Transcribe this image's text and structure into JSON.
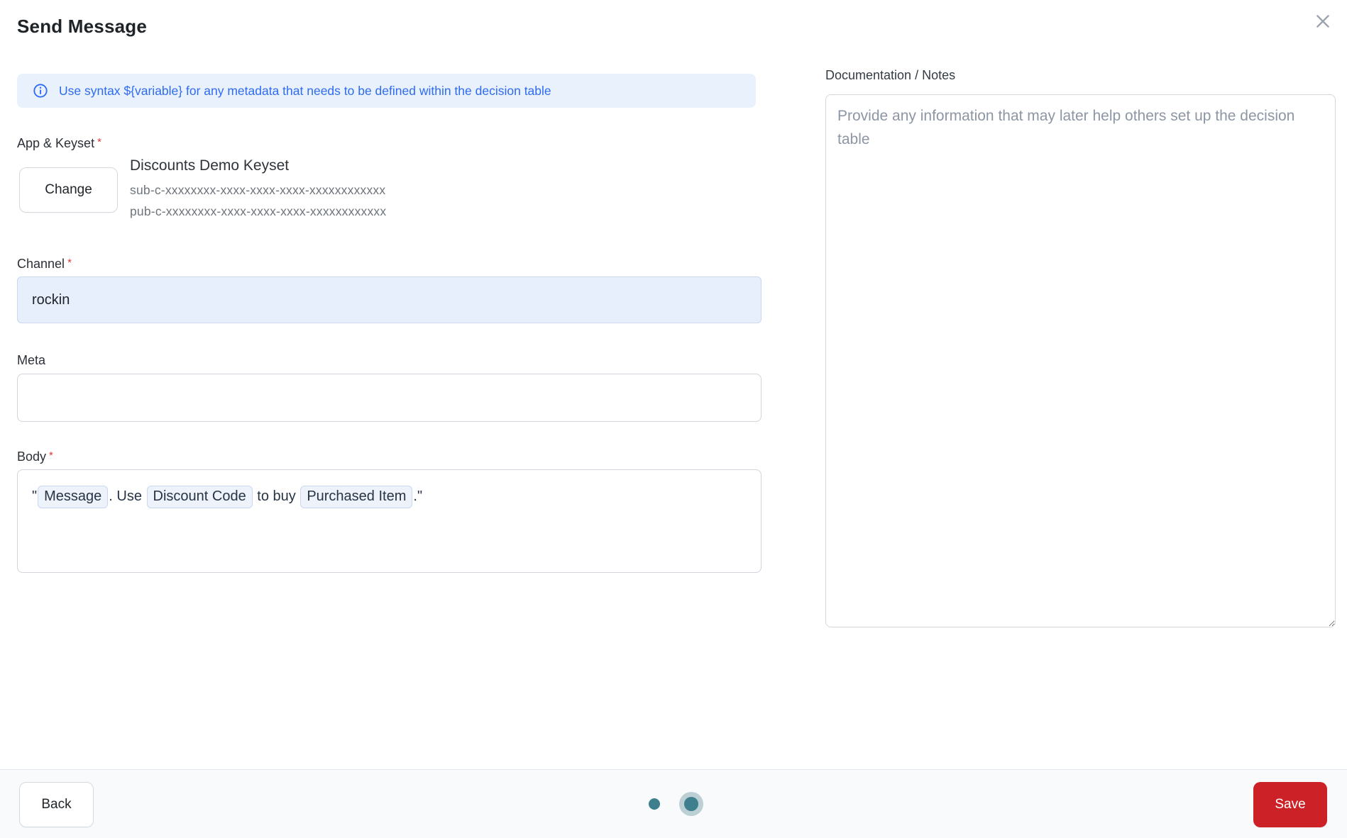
{
  "dialog": {
    "title": "Send Message"
  },
  "banner": {
    "text": "Use syntax ${variable} for any metadata that needs to be defined within the decision table"
  },
  "form": {
    "app_keyset": {
      "label": "App & Keyset",
      "required": "*",
      "change_button": "Change",
      "keyset_name": "Discounts Demo Keyset",
      "sub_key": "sub-c-xxxxxxxx-xxxx-xxxx-xxxx-xxxxxxxxxxxx",
      "pub_key": "pub-c-xxxxxxxx-xxxx-xxxx-xxxx-xxxxxxxxxxxx"
    },
    "channel": {
      "label": "Channel",
      "required": "*",
      "value": "rockin"
    },
    "meta": {
      "label": "Meta",
      "value": ""
    },
    "body": {
      "label": "Body",
      "required": "*",
      "segments": [
        {
          "type": "text",
          "text": "\""
        },
        {
          "type": "chip",
          "text": "Message"
        },
        {
          "type": "text",
          "text": ". Use "
        },
        {
          "type": "chip",
          "text": "Discount Code"
        },
        {
          "type": "text",
          "text": " to buy "
        },
        {
          "type": "chip",
          "text": "Purchased Item"
        },
        {
          "type": "text",
          "text": ".\""
        }
      ]
    }
  },
  "notes": {
    "label": "Documentation / Notes",
    "placeholder": "Provide any information that may later help others set up the decision table"
  },
  "footer": {
    "back_button": "Back",
    "save_button": "Save",
    "steps": [
      {
        "state": "inactive"
      },
      {
        "state": "active"
      }
    ]
  },
  "colors": {
    "accent_blue": "#2e6bf0",
    "banner_bg": "#e9f1fd",
    "channel_bg": "#e8effc",
    "chip_bg": "#edf2fb",
    "chip_border": "#c9d8ef",
    "save_red": "#cc2127",
    "dot_teal": "#3e7f8d",
    "dot_ring": "#bccfd4",
    "required_red": "#d93a3a"
  }
}
